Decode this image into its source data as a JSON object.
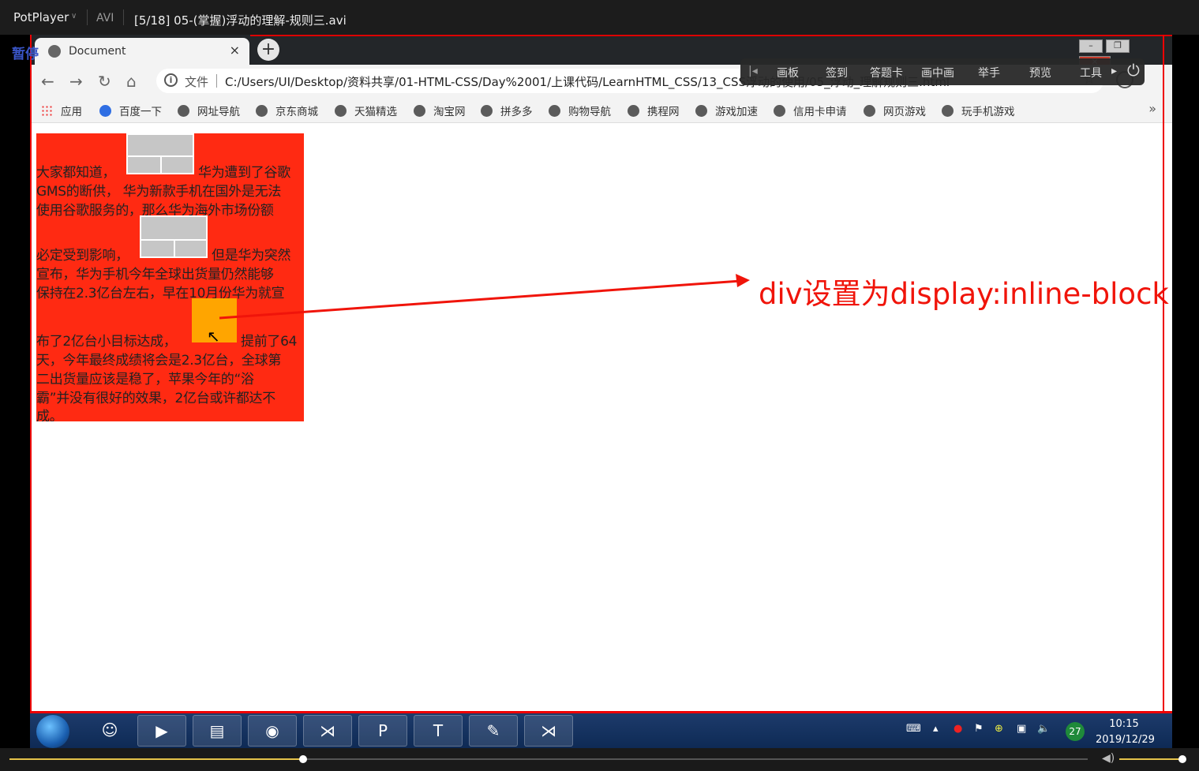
{
  "player": {
    "brand": "PotPlayer",
    "format": "AVI",
    "file_title": "[5/18] 05-(掌握)浮动的理解-规则三.avi",
    "pause_label": "暂停",
    "seek_progress": 0.272,
    "volume": 0.97
  },
  "browser": {
    "tab_title": "Document",
    "tab_close": "×",
    "new_tab": "+",
    "addr_word": "文件",
    "url": "C:/Users/UI/Desktop/资料共享/01-HTML-CSS/Day%2001/上课代码/LearnHTML_CSS/13_CSS浮动的使用/05_浮动_理解规则三.html",
    "bookmarks": [
      "应用",
      "百度一下",
      "网址导航",
      "京东商城",
      "天猫精选",
      "淘宝网",
      "拼多多",
      "购物导航",
      "携程网",
      "游戏加速",
      "信用卡申请",
      "网页游戏",
      "玩手机游戏"
    ],
    "more": "»"
  },
  "floatbar": {
    "items": [
      "画板",
      "签到",
      "答题卡",
      "画中画",
      "举手",
      "预览",
      "工具"
    ]
  },
  "content": {
    "lines": [
      "大家都知道，",
      "华为遭到了谷歌",
      "GMS的断供， 华为新款手机在国外是无法",
      "使用谷歌服务的，那么华为海外市场份额",
      "必定受到影响，",
      "但是华为突然",
      "宣布，华为手机今年全球出货量仍然能够",
      "保持在2.3亿台左右，早在10月份华为就宣",
      "布了2亿台小目标达成，",
      "提前了64",
      "天，今年最终成绩将会是2.3亿台，全球第",
      "二出货量应该是稳了，苹果今年的“浴",
      "霸”并没有很好的效果，2亿台或许都达不",
      "成。"
    ],
    "annotation": "div设置为display:inline-block"
  },
  "taskbar": {
    "time": "10:15",
    "date": "2019/12/29",
    "badge": "27"
  },
  "colors": {
    "box_red": "#ff2a12",
    "inline_block_orange": "#ffa500",
    "annotation_red": "#f0140a"
  }
}
